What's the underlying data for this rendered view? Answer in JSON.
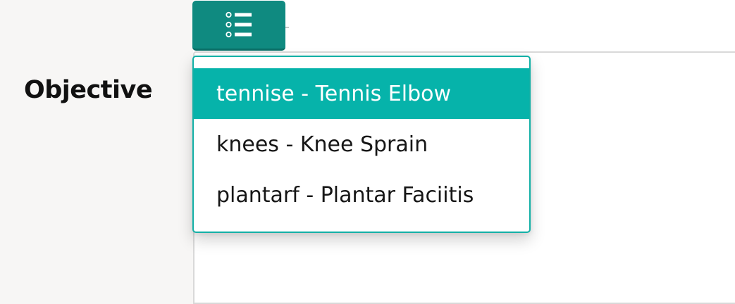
{
  "section": {
    "label": "Objective"
  },
  "toolbar": {
    "list_button_icon": "bulleted-list-icon",
    "accent_color": "#0f8a80"
  },
  "dropdown": {
    "highlight_color": "#06b3aa",
    "items": [
      {
        "label": "tennise - Tennis Elbow",
        "active": true
      },
      {
        "label": "knees - Knee Sprain",
        "active": false
      },
      {
        "label": "plantarf - Plantar Faciitis",
        "active": false
      }
    ]
  }
}
